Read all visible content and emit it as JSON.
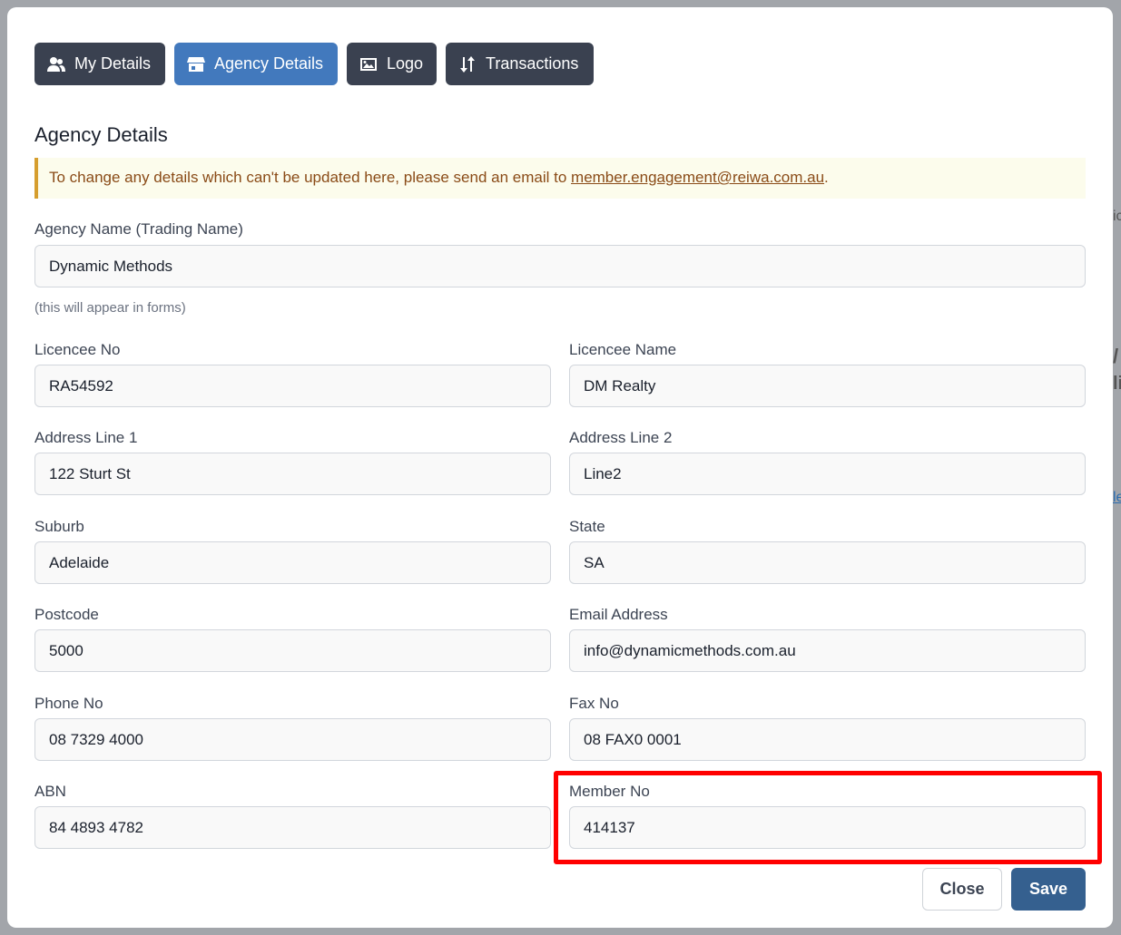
{
  "background": {
    "fragments": [
      "ic",
      "/",
      "li",
      "le"
    ]
  },
  "tabs": [
    {
      "label": "My Details",
      "icon": "users-icon"
    },
    {
      "label": "Agency Details",
      "icon": "store-icon",
      "active": true
    },
    {
      "label": "Logo",
      "icon": "image-icon"
    },
    {
      "label": "Transactions",
      "icon": "sort-icon"
    }
  ],
  "title": "Agency Details",
  "notice": {
    "text": "To change any details which can't be updated here, please send an email to ",
    "email": "member.engagement@reiwa.com.au",
    "end": "."
  },
  "agency_name": {
    "label": "Agency Name (Trading Name)",
    "value": "Dynamic Methods",
    "hint": "(this will appear in forms)"
  },
  "fields": [
    {
      "label": "Licencee No",
      "value": "RA54592"
    },
    {
      "label": "Licencee Name",
      "value": "DM Realty"
    },
    {
      "label": "Address Line 1",
      "value": "122 Sturt St"
    },
    {
      "label": "Address Line 2",
      "value": "Line2"
    },
    {
      "label": "Suburb",
      "value": "Adelaide"
    },
    {
      "label": "State",
      "value": "SA"
    },
    {
      "label": "Postcode",
      "value": "5000"
    },
    {
      "label": "Email Address",
      "value": "info@dynamicmethods.com.au"
    },
    {
      "label": "Phone No",
      "value": "08 7329 4000"
    },
    {
      "label": "Fax No",
      "value": "08 FAX0 0001"
    },
    {
      "label": "ABN",
      "value": "84 4893 4782"
    },
    {
      "label": "Member No",
      "value": "414137"
    }
  ],
  "buttons": {
    "close": "Close",
    "save": "Save"
  },
  "colors": {
    "active_tab": "#4279bd",
    "tab": "#3a4150",
    "save": "#35608f",
    "highlight": "#ff0000"
  }
}
